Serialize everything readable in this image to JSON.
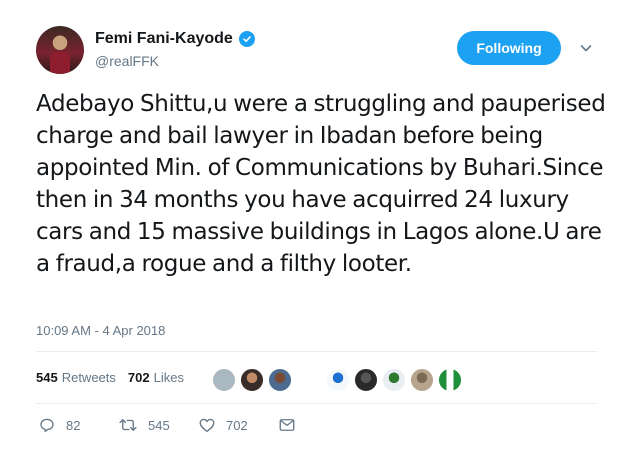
{
  "author": {
    "name": "Femi Fani-Kayode",
    "handle": "@realFFK",
    "verified": true
  },
  "follow_button": {
    "label": "Following"
  },
  "tweet": {
    "text": "Adebayo Shittu,u were a struggling and pauperised charge and bail lawyer in Ibadan before being appointed Min. of Communications by Buhari.Since then in 34 months you have acquirred 24 luxury cars and 15 massive buildings in Lagos alone.U are a fraud,a rogue and a filthy looter.",
    "timestamp": "10:09 AM - 4 Apr 2018"
  },
  "stats": {
    "retweets_count": "545",
    "retweets_label": "Retweets",
    "likes_count": "702",
    "likes_label": "Likes"
  },
  "actions": {
    "replies": "82",
    "retweets": "545",
    "likes": "702"
  },
  "colors": {
    "accent": "#1da1f2",
    "text": "#14171a",
    "muted": "#657786",
    "divider": "#e6ecf0"
  },
  "icons": [
    "verified-badge-icon",
    "chevron-down-icon",
    "reply-icon",
    "retweet-icon",
    "like-icon",
    "direct-message-icon"
  ]
}
